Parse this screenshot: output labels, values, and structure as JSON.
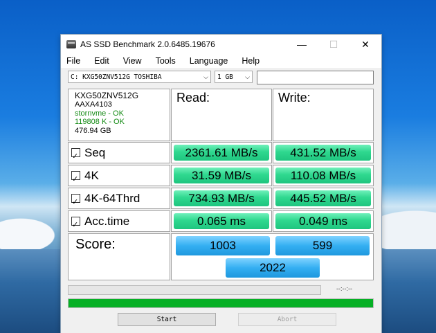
{
  "window": {
    "title": "AS SSD Benchmark 2.0.6485.19676",
    "minimize": "—",
    "maximize": "☐",
    "close": "✕"
  },
  "menu": [
    "File",
    "Edit",
    "View",
    "Tools",
    "Language",
    "Help"
  ],
  "toolbar": {
    "drive": "C: KXG50ZNV512G TOSHIBA",
    "size": "1 GB",
    "text": ""
  },
  "info": {
    "model": "KXG50ZNV512G",
    "firmware": "AAXA4103",
    "driver": "stornvme - OK",
    "alignment": "119808 K - OK",
    "capacity": "476.94 GB"
  },
  "headers": {
    "read": "Read:",
    "write": "Write:"
  },
  "tests": [
    {
      "label": "Seq",
      "read": "2361.61 MB/s",
      "write": "431.52 MB/s"
    },
    {
      "label": "4K",
      "read": "31.59 MB/s",
      "write": "110.08 MB/s"
    },
    {
      "label": "4K-64Thrd",
      "read": "734.93 MB/s",
      "write": "445.52 MB/s"
    },
    {
      "label": "Acc.time",
      "read": "0.065 ms",
      "write": "0.049 ms"
    }
  ],
  "score": {
    "label": "Score:",
    "read": "1003",
    "write": "599",
    "total": "2022"
  },
  "progress": {
    "time": "--:--:--",
    "percent": 100
  },
  "buttons": {
    "start": "Start",
    "abort": "Abort"
  }
}
